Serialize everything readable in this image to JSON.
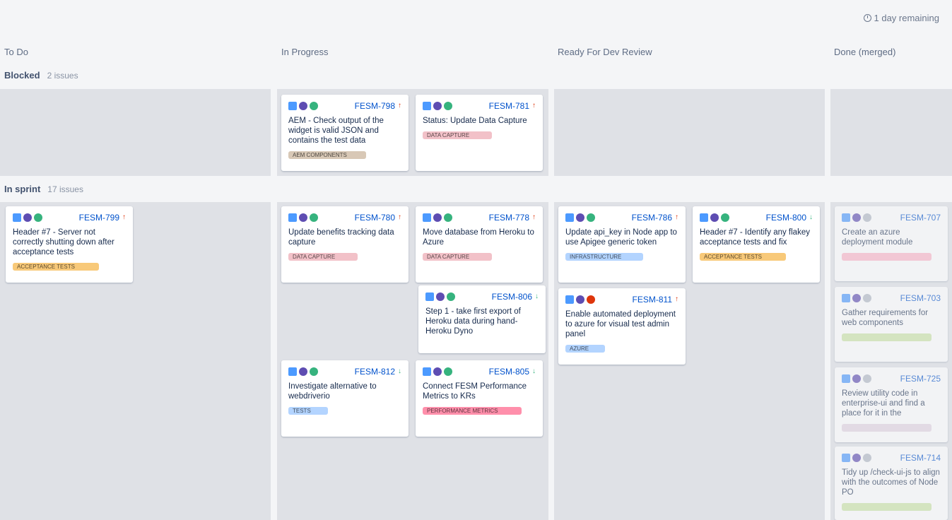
{
  "header": {
    "remaining": "1 day remaining"
  },
  "columns": [
    "To Do",
    "In Progress",
    "Ready For Dev Review",
    "Done (merged)"
  ],
  "swimlanes": [
    {
      "name": "Blocked",
      "count": "2 issues"
    },
    {
      "name": "In sprint",
      "count": "17 issues"
    }
  ],
  "cards": [
    {
      "key": "FESM-798",
      "priority": "high",
      "summary": "AEM - Check output of the widget is valid JSON and contains the test data",
      "label": "AEM COMPONENTS",
      "labelColor": "#d8c8b6"
    },
    {
      "key": "FESM-781",
      "priority": "high",
      "summary": "Status: Update Data Capture",
      "label": "DATA CAPTURE",
      "labelColor": "#f2c1c8"
    },
    {
      "key": "FESM-799",
      "priority": "high",
      "summary": "Header #7 - Server not correctly shutting down after acceptance tests",
      "label": "ACCEPTANCE TESTS",
      "labelColor": "#f8c979"
    },
    {
      "key": "FESM-780",
      "priority": "high",
      "summary": "Update benefits tracking data capture",
      "label": "DATA CAPTURE",
      "labelColor": "#f2c1c8"
    },
    {
      "key": "FESM-778",
      "priority": "high",
      "summary": "Move database from Heroku to Azure",
      "label": "DATA CAPTURE",
      "labelColor": "#f2c1c8"
    },
    {
      "key": "FESM-806",
      "priority": "low",
      "summary": "Step 1 - take first export of Heroku data during hand-Heroku Dyno",
      "label": "",
      "labelColor": ""
    },
    {
      "key": "FESM-812",
      "priority": "low",
      "summary": "Investigate alternative to webdriverio",
      "label": "TESTS",
      "labelColor": "#b3d4ff"
    },
    {
      "key": "FESM-805",
      "priority": "low",
      "summary": "Connect FESM Performance Metrics to KRs",
      "label": "PERFORMANCE METRICS",
      "labelColor": "#ff8fab"
    },
    {
      "key": "FESM-786",
      "priority": "high",
      "summary": "Update api_key in Node app to use Apigee generic token",
      "label": "INFRASTRUCTURE",
      "labelColor": "#b3d4ff"
    },
    {
      "key": "FESM-800",
      "priority": "low",
      "summary": "Header #7 - Identify any flakey acceptance tests and fix",
      "label": "ACCEPTANCE TESTS",
      "labelColor": "#f8c979"
    },
    {
      "key": "FESM-811",
      "priority": "high",
      "summary": "Enable automated deployment to azure for visual test admin panel",
      "label": "AZURE",
      "labelColor": "#b3d4ff"
    },
    {
      "key": "FESM-707",
      "priority": "",
      "summary": "Create an azure deployment module",
      "label": "",
      "labelColor": "#ffb7c9"
    },
    {
      "key": "FESM-703",
      "priority": "",
      "summary": "Gather requirements for web components",
      "label": "",
      "labelColor": "#cde6a8"
    },
    {
      "key": "FESM-725",
      "priority": "",
      "summary": "Review utility code in enterprise-ui and find a place for it in the",
      "label": "",
      "labelColor": "#e5d7e4"
    },
    {
      "key": "FESM-714",
      "priority": "",
      "summary": "Tidy up /check-ui-js to align with the outcomes of Node PO",
      "label": "",
      "labelColor": "#cde6a8"
    }
  ]
}
